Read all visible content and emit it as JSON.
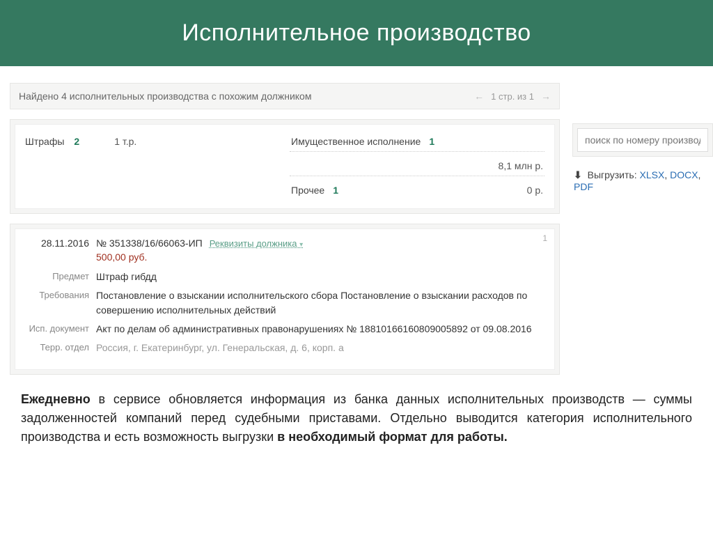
{
  "header": {
    "title": "Исполнительное производство"
  },
  "top": {
    "found_text": "Найдено 4 исполнительных производства с похожим должником",
    "pager_text": "1 стр. из 1"
  },
  "summary": {
    "fines_label": "Штрафы",
    "fines_count": "2",
    "fines_value": "1 т.р.",
    "prop_label": "Имущественное исполнение",
    "prop_count": "1",
    "prop_value": "8,1 млн р.",
    "other_label": "Прочее",
    "other_count": "1",
    "other_value": "0 р."
  },
  "card": {
    "num": "1",
    "date": "28.11.2016",
    "id": "№ 351338/16/66063-ИП",
    "link": "Реквизиты должника",
    "amount": "500,00 руб.",
    "subject_label": "Предмет",
    "subject_value": "Штраф гибдд",
    "demand_label": "Требования",
    "demand_value": "Постановление о взыскании исполнительского сбора Постановление о взыскании расходов по совершению исполнительных действий",
    "doc_label": "Исп. документ",
    "doc_value": "Акт по делам об административных правонарушениях № 18810166160809005892 от 09.08.2016",
    "dept_label": "Терр. отдел",
    "dept_value": "Россия, г. Екатеринбург, ул. Генеральская, д. 6, корп. а"
  },
  "search": {
    "placeholder": "поиск по номеру производства"
  },
  "export": {
    "label": "Выгрузить:",
    "xlsx": "XLSX",
    "docx": "DOCX",
    "pdf": "PDF"
  },
  "footer": {
    "bold1": "Ежедневно",
    "text1": " в сервисе обновляется информация из банка данных исполнительных производств — суммы задолженностей компаний перед судебными приставами. Отдельно выводится категория исполнительного производства и есть возможность выгрузки ",
    "bold2": "в необходимый формат для работы."
  }
}
